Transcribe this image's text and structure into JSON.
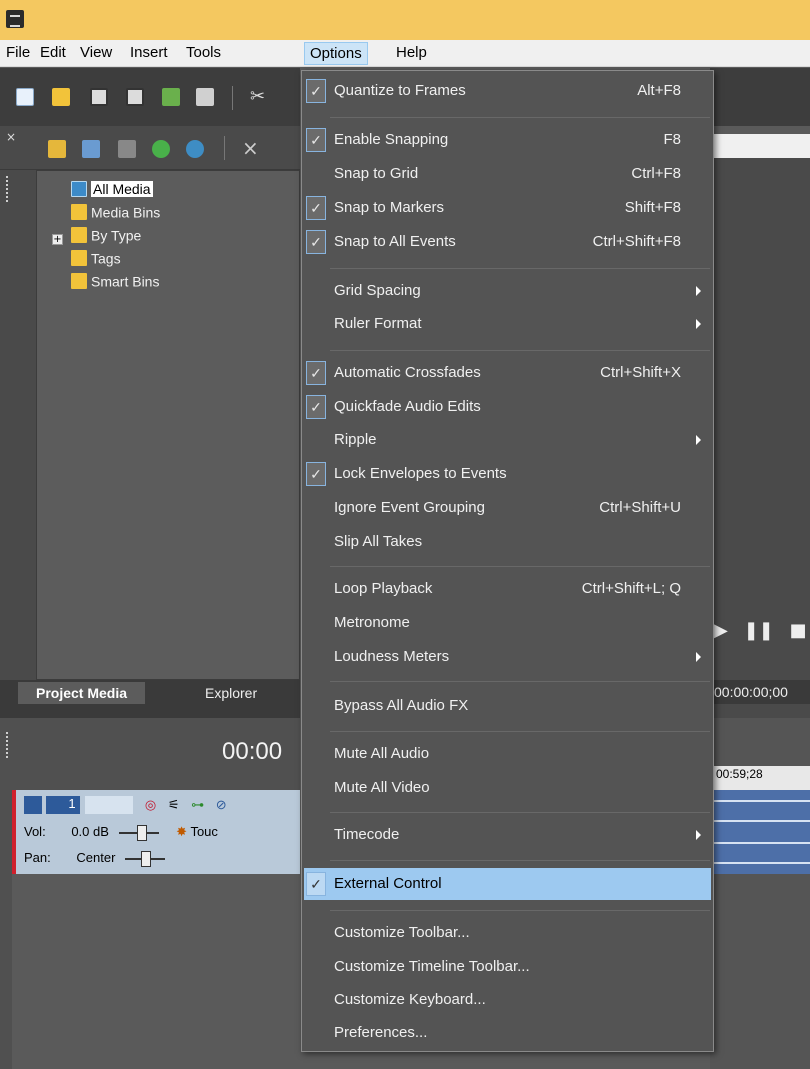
{
  "menubar": {
    "items": [
      "File",
      "Edit",
      "View",
      "Insert",
      "Tools",
      "Options",
      "Help"
    ],
    "active": "Options"
  },
  "media_tree": {
    "items": [
      "All Media",
      "Media Bins",
      "By Type",
      "Tags",
      "Smart Bins"
    ]
  },
  "tabs": {
    "project_media": "Project Media",
    "explorer": "Explorer"
  },
  "track": {
    "timecode": "00:00",
    "number": "1",
    "vol_label": "Vol:",
    "vol_value": "0.0 dB",
    "pan_label": "Pan:",
    "pan_value": "Center",
    "touch_label": "Touc"
  },
  "right": {
    "timecode": "00:00:00;00",
    "ruler_time": "00:59;28"
  },
  "menu": {
    "items": [
      {
        "label": "Quantize to Frames",
        "shortcut": "Alt+F8",
        "checked": true
      },
      {
        "label": "Enable Snapping",
        "shortcut": "F8",
        "checked": true
      },
      {
        "label": "Snap to Grid",
        "shortcut": "Ctrl+F8",
        "checked": false
      },
      {
        "label": "Snap to Markers",
        "shortcut": "Shift+F8",
        "checked": true
      },
      {
        "label": "Snap to All Events",
        "shortcut": "Ctrl+Shift+F8",
        "checked": true
      },
      {
        "label": "Grid Spacing",
        "shortcut": "",
        "submenu": true
      },
      {
        "label": "Ruler Format",
        "shortcut": "",
        "submenu": true
      },
      {
        "label": "Automatic Crossfades",
        "shortcut": "Ctrl+Shift+X",
        "checked": true
      },
      {
        "label": "Quickfade Audio Edits",
        "shortcut": "",
        "checked": true
      },
      {
        "label": "Ripple",
        "shortcut": "",
        "submenu": true
      },
      {
        "label": "Lock Envelopes to Events",
        "shortcut": "",
        "checked": true
      },
      {
        "label": "Ignore Event Grouping",
        "shortcut": "Ctrl+Shift+U",
        "checked": false
      },
      {
        "label": "Slip All Takes",
        "shortcut": "",
        "checked": false
      },
      {
        "label": "Loop Playback",
        "shortcut": "Ctrl+Shift+L; Q",
        "checked": false
      },
      {
        "label": "Metronome",
        "shortcut": "",
        "checked": false
      },
      {
        "label": "Loudness Meters",
        "shortcut": "",
        "submenu": true
      },
      {
        "label": "Bypass All Audio FX",
        "shortcut": "",
        "checked": false
      },
      {
        "label": "Mute All Audio",
        "shortcut": "",
        "checked": false
      },
      {
        "label": "Mute All Video",
        "shortcut": "",
        "checked": false
      },
      {
        "label": "Timecode",
        "shortcut": "",
        "submenu": true
      },
      {
        "label": "External Control",
        "shortcut": "",
        "checked": true,
        "highlighted": true
      },
      {
        "label": "Customize Toolbar...",
        "shortcut": ""
      },
      {
        "label": "Customize Timeline Toolbar...",
        "shortcut": ""
      },
      {
        "label": "Customize Keyboard...",
        "shortcut": ""
      },
      {
        "label": "Preferences...",
        "shortcut": ""
      }
    ],
    "check_glyph": "✓"
  },
  "colors": {
    "titlebar": "#f4c860",
    "menu_bg": "#545454",
    "highlight": "#9dc9f0",
    "track_header": "#b9c9d9",
    "track_accent": "#d0202c"
  }
}
